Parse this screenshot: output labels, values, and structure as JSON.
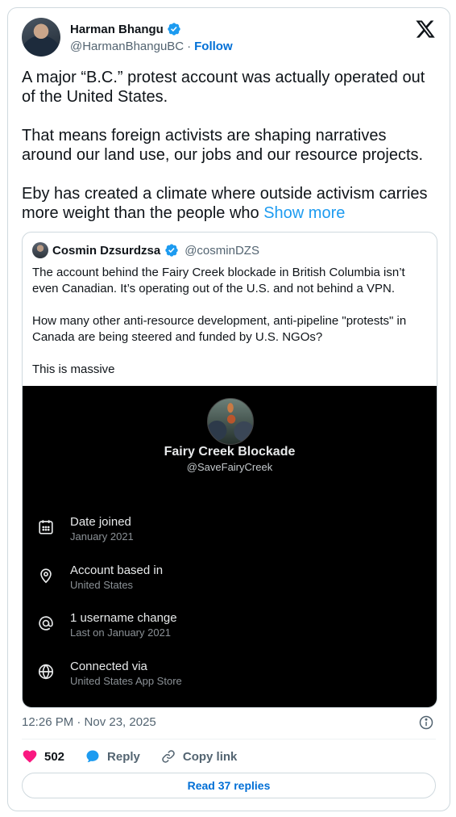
{
  "author": {
    "display_name": "Harman Bhangu",
    "handle": "@HarmanBhanguBC",
    "separator": "·",
    "follow_label": "Follow"
  },
  "tweet": {
    "paragraphs": [
      "A major “B.C.” protest account was actually operated out of the United States.",
      "That means foreign activists are shaping narratives around our land use, our jobs and our resource projects.",
      "Eby has created a climate where outside activism carries more weight than the people who"
    ],
    "show_more_label": "Show more",
    "timestamp": "12:26 PM · Nov 23, 2025"
  },
  "quote": {
    "display_name": "Cosmin Dzsurdzsa",
    "handle": "@cosminDZS",
    "paragraphs": [
      "The account behind the Fairy Creek blockade in British Columbia isn’t even Canadian. It’s operating out of the U.S. and not behind a VPN.",
      "How many other anti-resource development, anti-pipeline \"protests\" in Canada are being steered and funded by U.S. NGOs?",
      "This is massive"
    ],
    "media": {
      "profile_name": "Fairy Creek Blockade",
      "profile_handle": "@SaveFairyCreek",
      "rows": [
        {
          "icon": "calendar-icon",
          "title": "Date joined",
          "subtitle": "January 2021"
        },
        {
          "icon": "location-pin-icon",
          "title": "Account based in",
          "subtitle": "United States"
        },
        {
          "icon": "at-sign-icon",
          "title": "1 username change",
          "subtitle": "Last on January 2021"
        },
        {
          "icon": "globe-icon",
          "title": "Connected via",
          "subtitle": "United States App Store"
        }
      ]
    }
  },
  "actions": {
    "like_count": "502",
    "reply_label": "Reply",
    "copy_link_label": "Copy link",
    "read_replies_label": "Read 37 replies"
  },
  "colors": {
    "link_blue": "#1d9bf0",
    "follow_blue": "#006fd6",
    "like_pink": "#f91880",
    "verified_blue": "#1d9bf0",
    "secondary_text": "#536471"
  }
}
